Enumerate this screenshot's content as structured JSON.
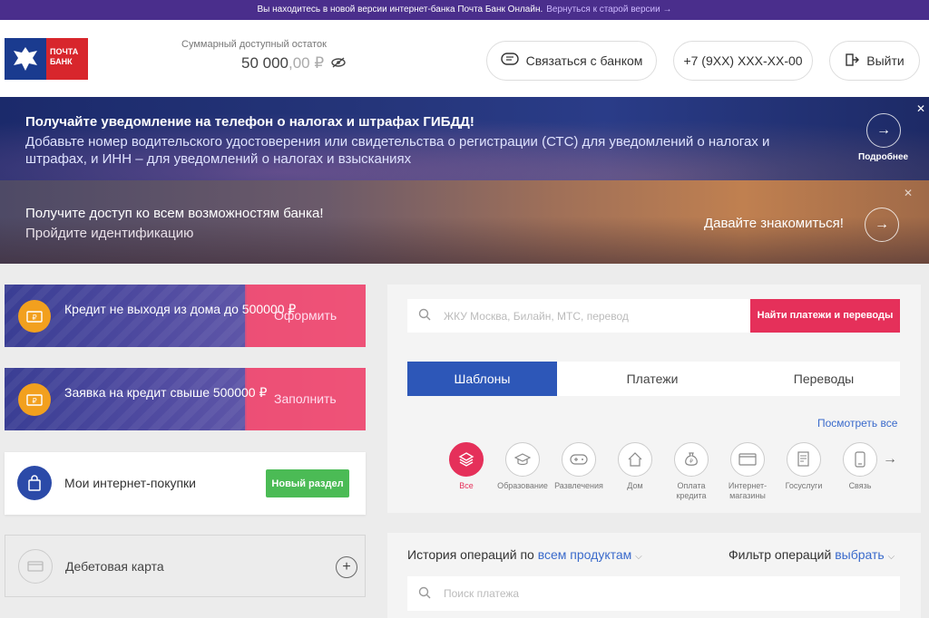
{
  "topbar": {
    "message": "Вы находитесь в новой версии интернет-банка Почта Банк Онлайн.",
    "back_link": "Вернуться к старой версии →"
  },
  "header": {
    "logo_text": "ПОЧТА БАНК",
    "balance_label": "Суммарный доступный остаток",
    "balance_int": "50 000",
    "balance_dec": ",00 ₽",
    "contact_label": "Связаться с банком",
    "phone_label": "+7 (9XX) XXX-XX-00",
    "exit_label": "Выйти"
  },
  "promo_notify": {
    "title": "Получайте уведомление на телефон о налогах и штрафах ГИБДД!",
    "text": "Добавьте номер водительского удостоверения или свидетельства о регистрации (СТС) для уведомлений о налогах и штрафах, и ИНН – для уведомлений о налогах и взысканиях",
    "more_label": "Подробнее",
    "close": "✕"
  },
  "promo_access": {
    "title": "Получите доступ ко всем возможностям банка!",
    "subtitle": "Пройдите идентификацию",
    "cta": "Давайте знакомиться!",
    "close": "✕"
  },
  "cards": {
    "loan1": {
      "text": "Кредит не выходя из дома до 500000 ₽",
      "action": "Оформить"
    },
    "loan2": {
      "text": "Заявка на кредит свыше 500000 ₽",
      "action": "Заполнить"
    },
    "shopping": {
      "text": "Мои интернет-покупки",
      "badge": "Новый раздел"
    },
    "debit": {
      "text": "Дебетовая карта",
      "plus": "+"
    }
  },
  "payments": {
    "search_placeholder": "ЖКУ Москва, Билайн, МТС, перевод",
    "find_button": "Найти платежи и переводы",
    "tabs": [
      "Шаблоны",
      "Платежи",
      "Переводы"
    ],
    "see_all": "Посмотреть все",
    "categories": [
      {
        "label": "Все",
        "icon": "layers-icon"
      },
      {
        "label": "Образование",
        "icon": "graduation-cap-icon"
      },
      {
        "label": "Развлечения",
        "icon": "gamepad-icon"
      },
      {
        "label": "Дом",
        "icon": "home-icon"
      },
      {
        "label": "Оплата кредита",
        "icon": "money-bag-icon"
      },
      {
        "label": "Интернет-магазины",
        "icon": "card-icon"
      },
      {
        "label": "Госуслуги",
        "icon": "document-icon"
      },
      {
        "label": "Связь",
        "icon": "phone-icon"
      }
    ],
    "next": "→"
  },
  "history": {
    "label": "История операций по",
    "products_link": "всем продуктам",
    "filter_label": "Фильтр операций",
    "filter_link": "выбрать",
    "search_placeholder": "Поиск платежа"
  },
  "colors": {
    "accent_pink": "#e5305a",
    "accent_blue": "#2d57b8",
    "brand_red": "#d8262c",
    "badge_green": "#4bbb55"
  }
}
